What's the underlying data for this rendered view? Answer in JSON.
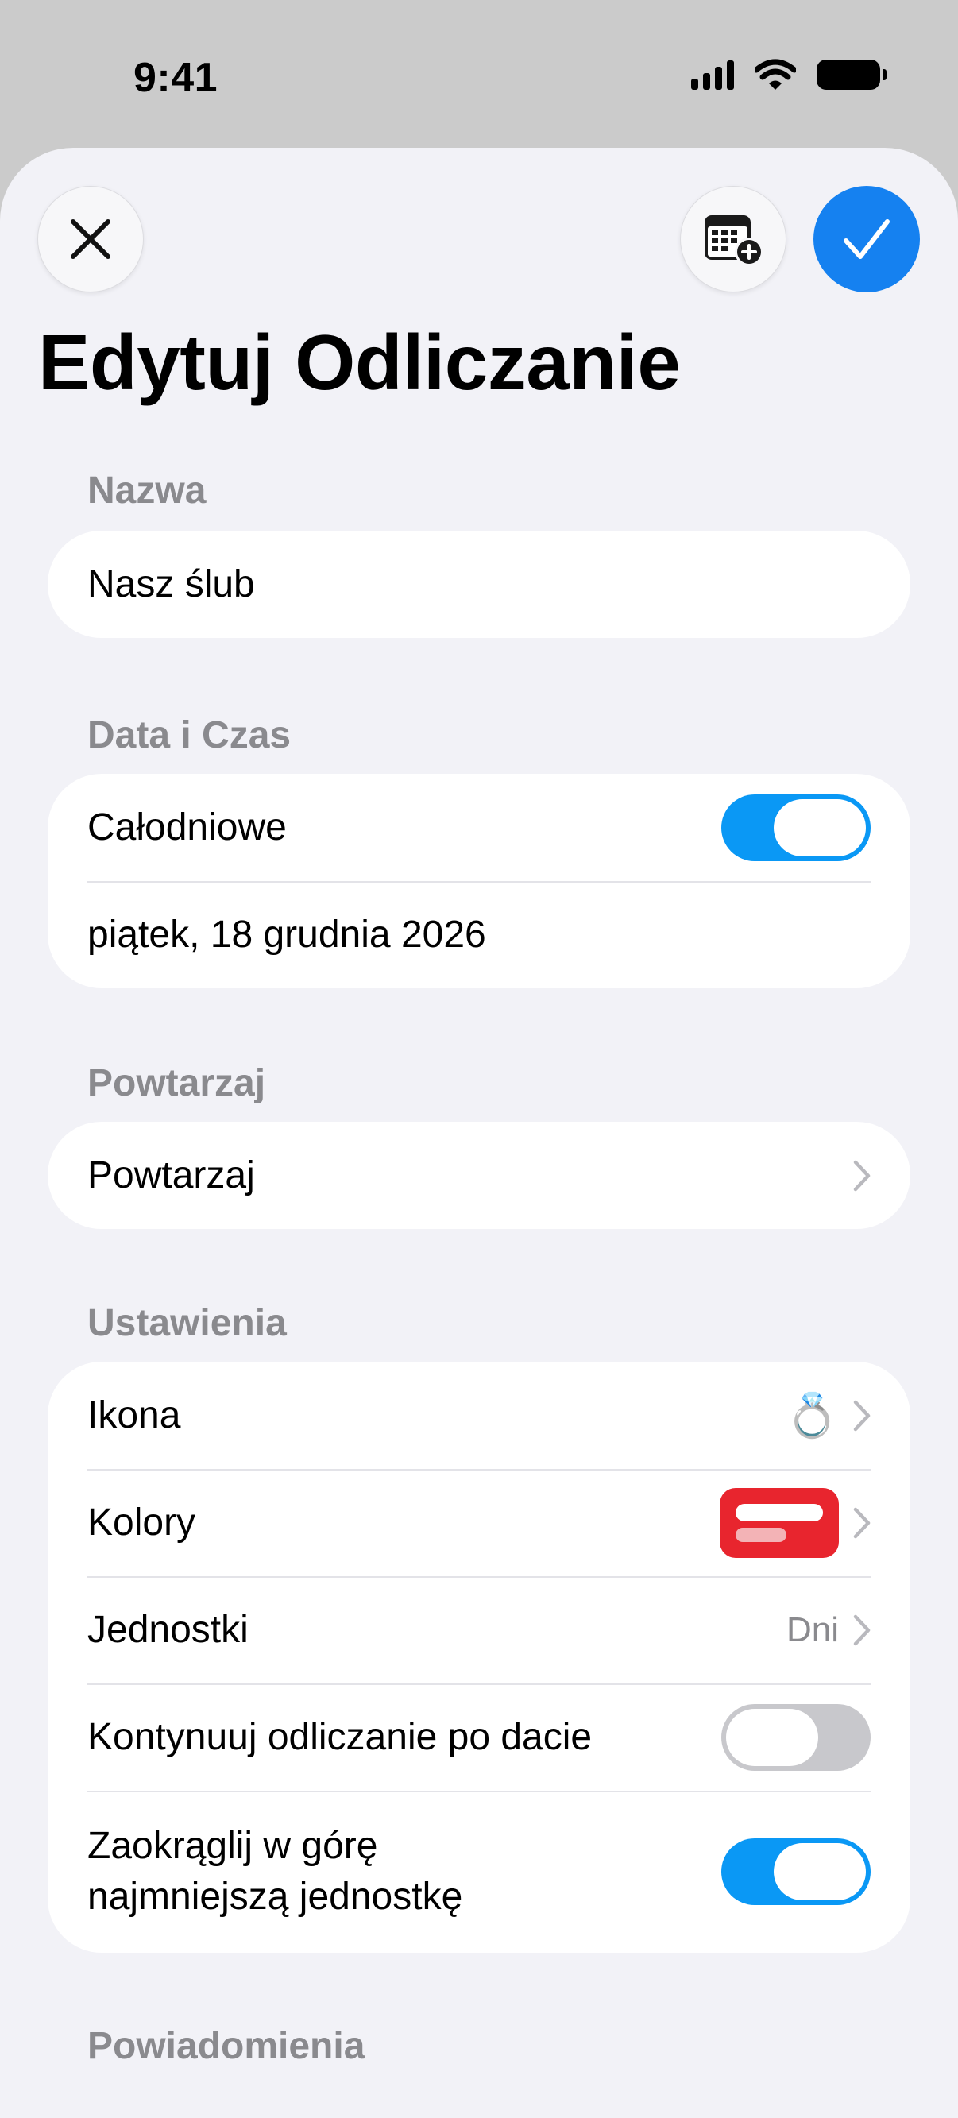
{
  "status_bar": {
    "time": "9:41"
  },
  "header": {
    "title": "Edytuj Odliczanie"
  },
  "sections": {
    "name": {
      "header": "Nazwa",
      "value": "Nasz ślub"
    },
    "datetime": {
      "header": "Data i Czas",
      "all_day_label": "Całodniowe",
      "all_day_on": true,
      "date": "piątek, 18 grudnia 2026"
    },
    "repeat": {
      "header": "Powtarzaj",
      "label": "Powtarzaj"
    },
    "settings": {
      "header": "Ustawienia",
      "icon_label": "Ikona",
      "icon_value": "💍",
      "colors_label": "Kolory",
      "colors_value": "#e8252e",
      "units_label": "Jednostki",
      "units_value": "Dni",
      "continue_label": "Kontynuuj odliczanie po dacie",
      "continue_on": false,
      "round_up_line1": "Zaokrąglij w górę",
      "round_up_line2": "najmniejszą jednostkę",
      "round_up_on": true
    },
    "notifications": {
      "header": "Powiadomienia"
    }
  },
  "icons": {
    "close": "close-icon",
    "calendar_add": "calendar-add-icon",
    "confirm": "checkmark-icon",
    "chevron": "chevron-right-icon"
  },
  "colors": {
    "accent": "#1581f0",
    "toggle_on": "#0a98f5",
    "toggle_off": "#c8c8cc"
  }
}
